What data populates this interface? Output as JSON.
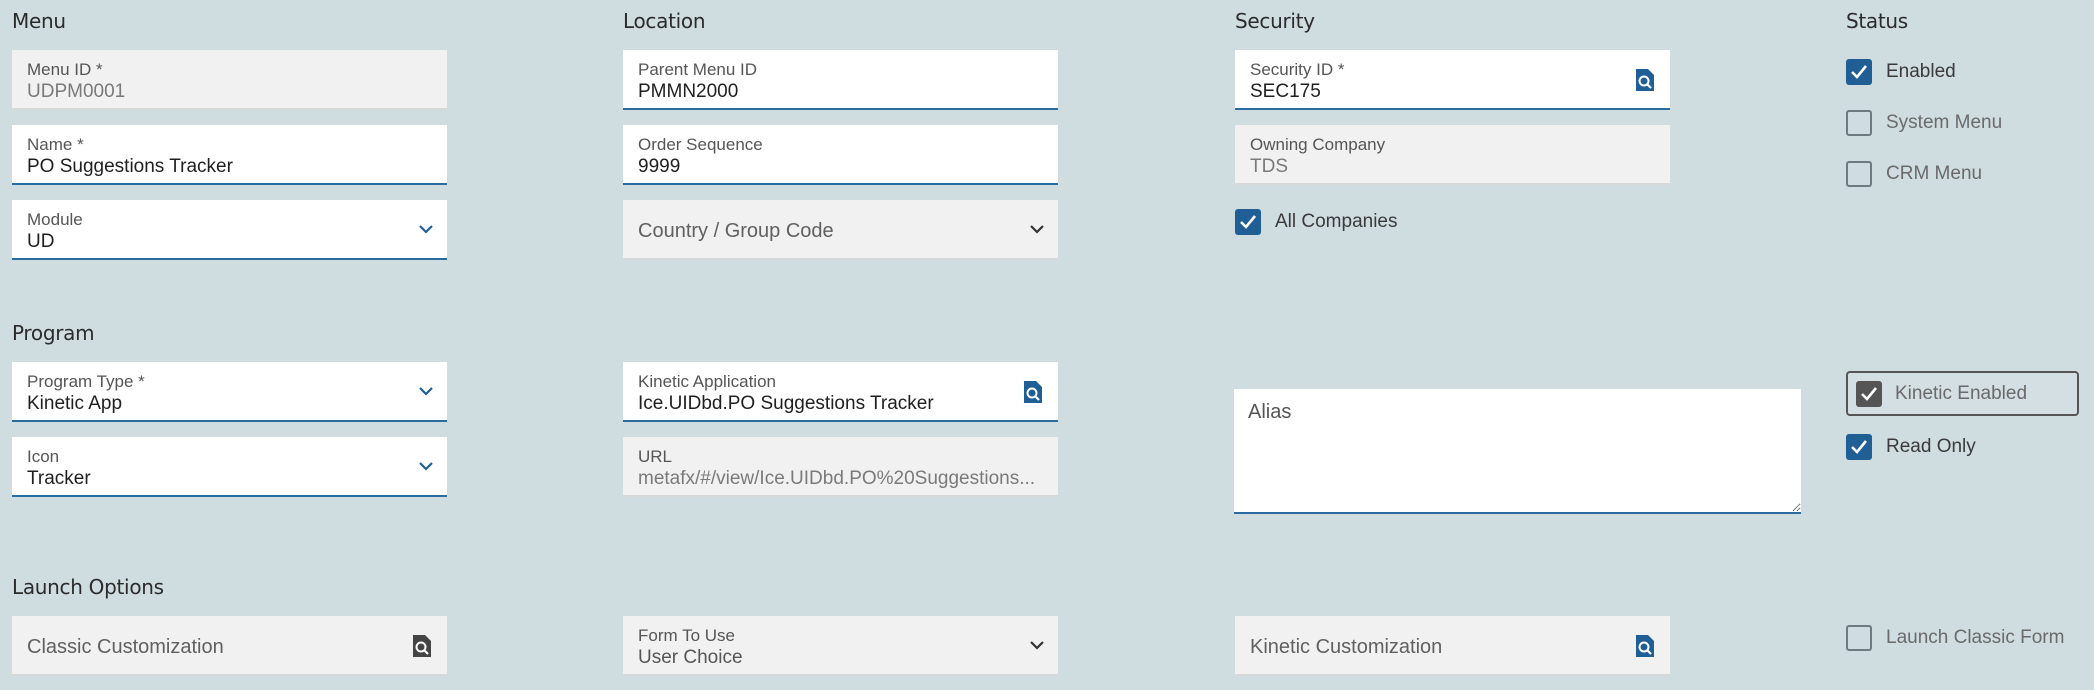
{
  "sections": {
    "menu": "Menu",
    "location": "Location",
    "security": "Security",
    "status": "Status",
    "program": "Program",
    "launch_options": "Launch Options"
  },
  "menu": {
    "menu_id": {
      "label": "Menu ID *",
      "value": "UDPM0001"
    },
    "name": {
      "label": "Name *",
      "value": "PO Suggestions Tracker"
    },
    "module": {
      "label": "Module",
      "value": "UD"
    }
  },
  "location": {
    "parent_menu_id": {
      "label": "Parent Menu ID",
      "value": "PMMN2000"
    },
    "order_sequence": {
      "label": "Order Sequence",
      "value": "9999"
    },
    "country_group_code": {
      "placeholder": "Country / Group Code"
    }
  },
  "security": {
    "security_id": {
      "label": "Security ID *",
      "value": "SEC175"
    },
    "owning_company": {
      "label": "Owning Company",
      "value": "TDS"
    },
    "all_companies": {
      "label": "All Companies",
      "checked": true
    }
  },
  "status": {
    "enabled": {
      "label": "Enabled",
      "checked": true
    },
    "system_menu": {
      "label": "System Menu",
      "checked": false
    },
    "crm_menu": {
      "label": "CRM Menu",
      "checked": false
    }
  },
  "program": {
    "program_type": {
      "label": "Program Type *",
      "value": "Kinetic App"
    },
    "icon": {
      "label": "Icon",
      "value": "Tracker"
    },
    "kinetic_application": {
      "label": "Kinetic Application",
      "value": "Ice.UIDbd.PO Suggestions Tracker"
    },
    "url": {
      "label": "URL",
      "value": "metafx/#/view/Ice.UIDbd.PO%20Suggestions..."
    },
    "alias": {
      "placeholder": "Alias"
    },
    "kinetic_enabled": {
      "label": "Kinetic Enabled",
      "checked": true
    },
    "read_only": {
      "label": "Read Only",
      "checked": true
    }
  },
  "launch": {
    "classic_customization": {
      "placeholder": "Classic Customization"
    },
    "form_to_use": {
      "label": "Form To Use",
      "value": "User Choice"
    },
    "kinetic_customization": {
      "placeholder": "Kinetic Customization"
    },
    "launch_classic_form": {
      "label": "Launch Classic Form",
      "checked": false
    }
  },
  "icons": {
    "lookup": "search-document-icon",
    "dropdown": "chevron-down-icon",
    "check": "checkmark-icon"
  },
  "colors": {
    "background": "#cfdde1",
    "accent": "#1f5f96",
    "field_underline": "#2a6ca0"
  }
}
